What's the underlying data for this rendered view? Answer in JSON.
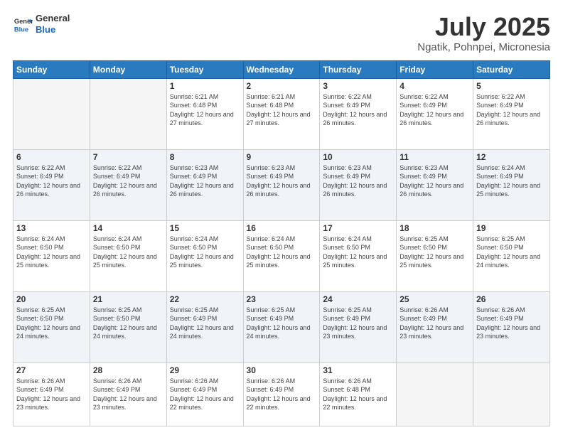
{
  "header": {
    "logo_line1": "General",
    "logo_line2": "Blue",
    "title": "July 2025",
    "subtitle": "Ngatik, Pohnpei, Micronesia"
  },
  "days_of_week": [
    "Sunday",
    "Monday",
    "Tuesday",
    "Wednesday",
    "Thursday",
    "Friday",
    "Saturday"
  ],
  "weeks": [
    [
      {
        "day": "",
        "sunrise": "",
        "sunset": "",
        "daylight": ""
      },
      {
        "day": "",
        "sunrise": "",
        "sunset": "",
        "daylight": ""
      },
      {
        "day": "1",
        "sunrise": "Sunrise: 6:21 AM",
        "sunset": "Sunset: 6:48 PM",
        "daylight": "Daylight: 12 hours and 27 minutes."
      },
      {
        "day": "2",
        "sunrise": "Sunrise: 6:21 AM",
        "sunset": "Sunset: 6:48 PM",
        "daylight": "Daylight: 12 hours and 27 minutes."
      },
      {
        "day": "3",
        "sunrise": "Sunrise: 6:22 AM",
        "sunset": "Sunset: 6:49 PM",
        "daylight": "Daylight: 12 hours and 26 minutes."
      },
      {
        "day": "4",
        "sunrise": "Sunrise: 6:22 AM",
        "sunset": "Sunset: 6:49 PM",
        "daylight": "Daylight: 12 hours and 26 minutes."
      },
      {
        "day": "5",
        "sunrise": "Sunrise: 6:22 AM",
        "sunset": "Sunset: 6:49 PM",
        "daylight": "Daylight: 12 hours and 26 minutes."
      }
    ],
    [
      {
        "day": "6",
        "sunrise": "Sunrise: 6:22 AM",
        "sunset": "Sunset: 6:49 PM",
        "daylight": "Daylight: 12 hours and 26 minutes."
      },
      {
        "day": "7",
        "sunrise": "Sunrise: 6:22 AM",
        "sunset": "Sunset: 6:49 PM",
        "daylight": "Daylight: 12 hours and 26 minutes."
      },
      {
        "day": "8",
        "sunrise": "Sunrise: 6:23 AM",
        "sunset": "Sunset: 6:49 PM",
        "daylight": "Daylight: 12 hours and 26 minutes."
      },
      {
        "day": "9",
        "sunrise": "Sunrise: 6:23 AM",
        "sunset": "Sunset: 6:49 PM",
        "daylight": "Daylight: 12 hours and 26 minutes."
      },
      {
        "day": "10",
        "sunrise": "Sunrise: 6:23 AM",
        "sunset": "Sunset: 6:49 PM",
        "daylight": "Daylight: 12 hours and 26 minutes."
      },
      {
        "day": "11",
        "sunrise": "Sunrise: 6:23 AM",
        "sunset": "Sunset: 6:49 PM",
        "daylight": "Daylight: 12 hours and 26 minutes."
      },
      {
        "day": "12",
        "sunrise": "Sunrise: 6:24 AM",
        "sunset": "Sunset: 6:49 PM",
        "daylight": "Daylight: 12 hours and 25 minutes."
      }
    ],
    [
      {
        "day": "13",
        "sunrise": "Sunrise: 6:24 AM",
        "sunset": "Sunset: 6:50 PM",
        "daylight": "Daylight: 12 hours and 25 minutes."
      },
      {
        "day": "14",
        "sunrise": "Sunrise: 6:24 AM",
        "sunset": "Sunset: 6:50 PM",
        "daylight": "Daylight: 12 hours and 25 minutes."
      },
      {
        "day": "15",
        "sunrise": "Sunrise: 6:24 AM",
        "sunset": "Sunset: 6:50 PM",
        "daylight": "Daylight: 12 hours and 25 minutes."
      },
      {
        "day": "16",
        "sunrise": "Sunrise: 6:24 AM",
        "sunset": "Sunset: 6:50 PM",
        "daylight": "Daylight: 12 hours and 25 minutes."
      },
      {
        "day": "17",
        "sunrise": "Sunrise: 6:24 AM",
        "sunset": "Sunset: 6:50 PM",
        "daylight": "Daylight: 12 hours and 25 minutes."
      },
      {
        "day": "18",
        "sunrise": "Sunrise: 6:25 AM",
        "sunset": "Sunset: 6:50 PM",
        "daylight": "Daylight: 12 hours and 25 minutes."
      },
      {
        "day": "19",
        "sunrise": "Sunrise: 6:25 AM",
        "sunset": "Sunset: 6:50 PM",
        "daylight": "Daylight: 12 hours and 24 minutes."
      }
    ],
    [
      {
        "day": "20",
        "sunrise": "Sunrise: 6:25 AM",
        "sunset": "Sunset: 6:50 PM",
        "daylight": "Daylight: 12 hours and 24 minutes."
      },
      {
        "day": "21",
        "sunrise": "Sunrise: 6:25 AM",
        "sunset": "Sunset: 6:50 PM",
        "daylight": "Daylight: 12 hours and 24 minutes."
      },
      {
        "day": "22",
        "sunrise": "Sunrise: 6:25 AM",
        "sunset": "Sunset: 6:49 PM",
        "daylight": "Daylight: 12 hours and 24 minutes."
      },
      {
        "day": "23",
        "sunrise": "Sunrise: 6:25 AM",
        "sunset": "Sunset: 6:49 PM",
        "daylight": "Daylight: 12 hours and 24 minutes."
      },
      {
        "day": "24",
        "sunrise": "Sunrise: 6:25 AM",
        "sunset": "Sunset: 6:49 PM",
        "daylight": "Daylight: 12 hours and 23 minutes."
      },
      {
        "day": "25",
        "sunrise": "Sunrise: 6:26 AM",
        "sunset": "Sunset: 6:49 PM",
        "daylight": "Daylight: 12 hours and 23 minutes."
      },
      {
        "day": "26",
        "sunrise": "Sunrise: 6:26 AM",
        "sunset": "Sunset: 6:49 PM",
        "daylight": "Daylight: 12 hours and 23 minutes."
      }
    ],
    [
      {
        "day": "27",
        "sunrise": "Sunrise: 6:26 AM",
        "sunset": "Sunset: 6:49 PM",
        "daylight": "Daylight: 12 hours and 23 minutes."
      },
      {
        "day": "28",
        "sunrise": "Sunrise: 6:26 AM",
        "sunset": "Sunset: 6:49 PM",
        "daylight": "Daylight: 12 hours and 23 minutes."
      },
      {
        "day": "29",
        "sunrise": "Sunrise: 6:26 AM",
        "sunset": "Sunset: 6:49 PM",
        "daylight": "Daylight: 12 hours and 22 minutes."
      },
      {
        "day": "30",
        "sunrise": "Sunrise: 6:26 AM",
        "sunset": "Sunset: 6:49 PM",
        "daylight": "Daylight: 12 hours and 22 minutes."
      },
      {
        "day": "31",
        "sunrise": "Sunrise: 6:26 AM",
        "sunset": "Sunset: 6:48 PM",
        "daylight": "Daylight: 12 hours and 22 minutes."
      },
      {
        "day": "",
        "sunrise": "",
        "sunset": "",
        "daylight": ""
      },
      {
        "day": "",
        "sunrise": "",
        "sunset": "",
        "daylight": ""
      }
    ]
  ]
}
